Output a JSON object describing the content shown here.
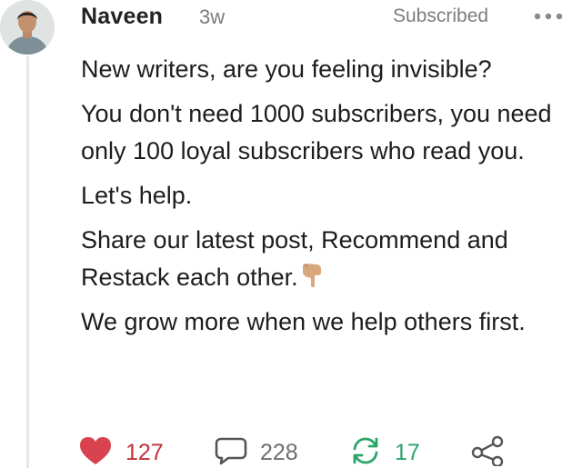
{
  "post": {
    "author": "Naveen",
    "time_ago": "3w",
    "subscription_status": "Subscribed",
    "paragraphs": [
      "New writers, are you feeling invisible?",
      "You don't need 1000 subscribers, you need only 100 loyal subscribers who read you.",
      "Let's help.",
      "Share our latest post, Recommend and Restack each other.",
      "We grow more when we help others first."
    ],
    "emoji_icon": "pointing-down-hand-icon"
  },
  "actions": {
    "likes": "127",
    "comments": "228",
    "restacks": "17"
  },
  "colors": {
    "like": "#d9424f",
    "restack": "#2aa56a",
    "muted": "#7d7d7d"
  }
}
